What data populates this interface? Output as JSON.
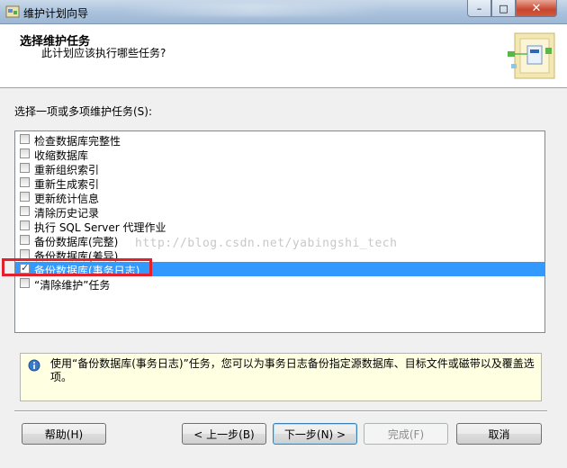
{
  "window": {
    "title": "维护计划向导",
    "controls": {
      "minimize": "–",
      "maximize": "□",
      "close": "✕"
    }
  },
  "header": {
    "title": "选择维护任务",
    "subtitle": "此计划应该执行哪些任务?"
  },
  "prompt": "选择一项或多项维护任务(S):",
  "tasks": [
    {
      "label": "检查数据库完整性",
      "checked": false,
      "selected": false
    },
    {
      "label": "收缩数据库",
      "checked": false,
      "selected": false
    },
    {
      "label": "重新组织索引",
      "checked": false,
      "selected": false
    },
    {
      "label": "重新生成索引",
      "checked": false,
      "selected": false
    },
    {
      "label": "更新统计信息",
      "checked": false,
      "selected": false
    },
    {
      "label": "清除历史记录",
      "checked": false,
      "selected": false
    },
    {
      "label": "执行 SQL Server 代理作业",
      "checked": false,
      "selected": false
    },
    {
      "label": "备份数据库(完整)",
      "checked": false,
      "selected": false
    },
    {
      "label": "备份数据库(差异)",
      "checked": false,
      "selected": false
    },
    {
      "label": "备份数据库(事务日志)",
      "checked": true,
      "selected": true
    },
    {
      "label": "“清除维护”任务",
      "checked": false,
      "selected": false
    }
  ],
  "watermark": "http://blog.csdn.net/yabingshi_tech",
  "description": "使用“备份数据库(事务日志)”任务，您可以为事务日志备份指定源数据库、目标文件或磁带以及覆盖选项。",
  "buttons": {
    "help": "帮助(H)",
    "back": "< 上一步(B)",
    "next": "下一步(N) >",
    "finish": "完成(F)",
    "cancel": "取消"
  },
  "colors": {
    "selection": "#3399ff",
    "highlight_box": "#e3212c",
    "info_background": "#ffffe1"
  }
}
